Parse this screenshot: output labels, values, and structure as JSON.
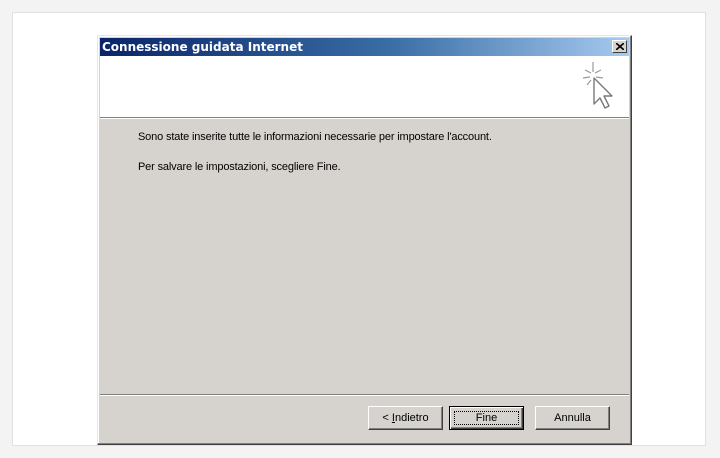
{
  "window": {
    "title": "Connessione guidata Internet",
    "close_glyph": "×"
  },
  "content": {
    "line1": "Sono state inserite tutte le informazioni necessarie per impostare l'account.",
    "line2": "Per salvare le impostazioni, scegliere Fine."
  },
  "buttons": {
    "back_prefix": "< ",
    "back_mnemonic": "I",
    "back_rest": "ndietro",
    "finish": "Fine",
    "cancel": "Annulla"
  },
  "icons": {
    "close": "close-icon",
    "wizard": "wizard-cursor-sparkle-icon"
  },
  "colors": {
    "titlebar_start": "#0a246a",
    "titlebar_end": "#a6caf0",
    "dialog_face": "#d6d3ce"
  }
}
